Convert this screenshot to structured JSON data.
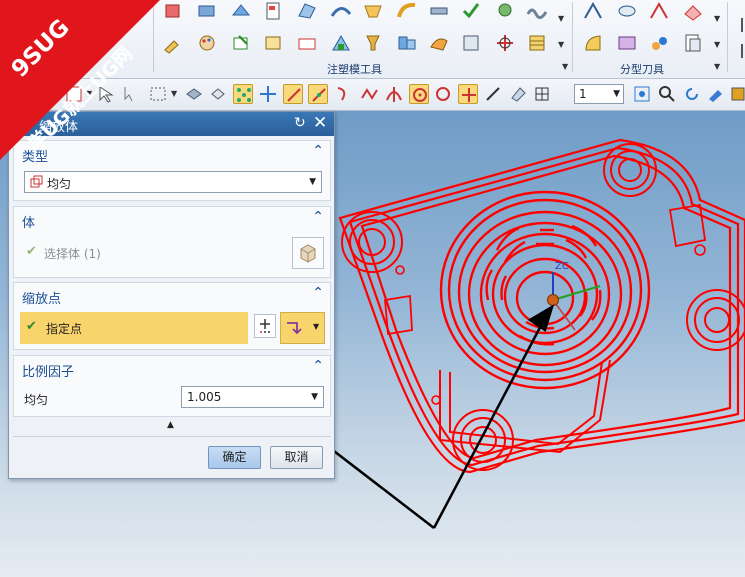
{
  "ribbon": {
    "groups": [
      {
        "label": "注塑模工具"
      },
      {
        "label": "分型刀具"
      }
    ]
  },
  "toolbar": {
    "layer_value": "1"
  },
  "dialog": {
    "title": "缩放体",
    "type_section": {
      "header": "类型",
      "value": "均匀"
    },
    "body_section": {
      "header": "体",
      "select_label": "选择体 (1)"
    },
    "point_section": {
      "header": "缩放点",
      "specify_label": "指定点"
    },
    "factor_section": {
      "header": "比例因子",
      "label": "均匀",
      "value": "1.005"
    },
    "ok_label": "确定",
    "cancel_label": "取消"
  },
  "watermark": {
    "line1": "9SUG",
    "line2": "学UG就上UG网"
  },
  "colors": {
    "model_wire": "#ff0000",
    "title_bar": "#2e6aa8",
    "highlight": "#f9d36b",
    "watermark_red": "#e0161c"
  }
}
